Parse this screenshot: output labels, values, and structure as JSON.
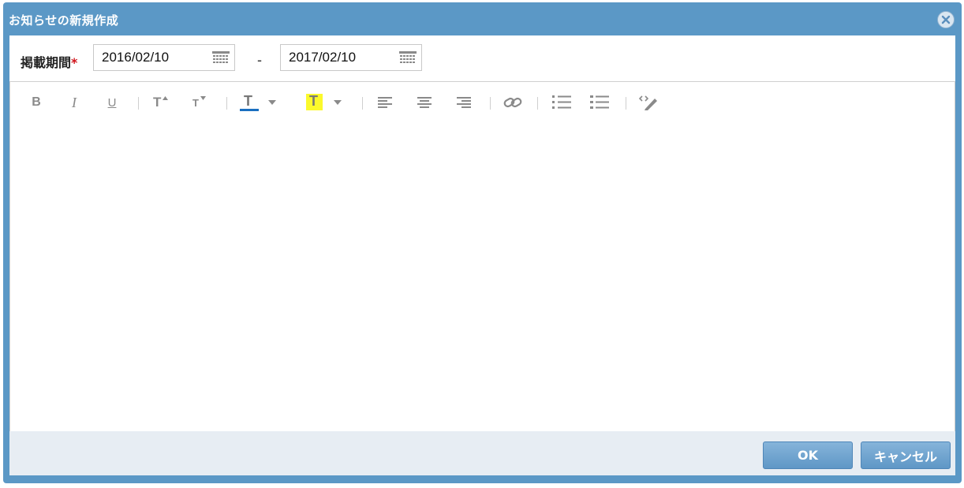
{
  "dialog": {
    "title": "お知らせの新規作成",
    "close_icon": "close-circle-icon"
  },
  "period": {
    "label": "掲載期間",
    "required_mark": "*",
    "start_date": "2016/02/10",
    "separator": "-",
    "end_date": "2017/02/10",
    "calendar_icon": "calendar-icon"
  },
  "toolbar": {
    "bold": "B",
    "italic": "I",
    "underline": "U",
    "font_size_up": "T",
    "font_size_down": "T",
    "text_color": "T",
    "highlight": "T",
    "text_color_value": "#1a6fc0",
    "highlight_color_value": "#fbf92c",
    "icons": [
      "bold-icon",
      "italic-icon",
      "underline-icon",
      "font-size-increase-icon",
      "font-size-decrease-icon",
      "text-color-icon",
      "highlight-color-icon",
      "align-left-icon",
      "align-center-icon",
      "align-right-icon",
      "link-icon",
      "ordered-list-icon",
      "unordered-list-icon",
      "source-edit-icon"
    ]
  },
  "editor": {
    "content": ""
  },
  "footer": {
    "ok_label": "OK",
    "cancel_label": "キャンセル"
  }
}
